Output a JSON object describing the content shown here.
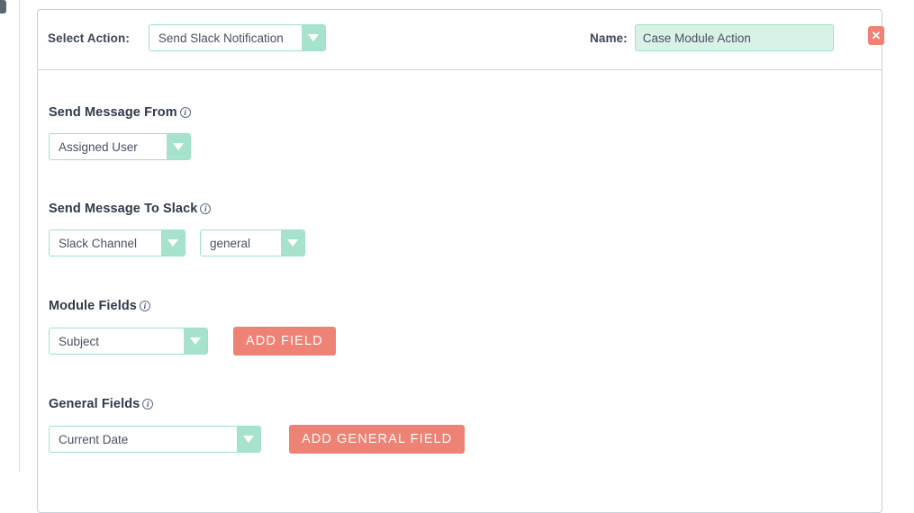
{
  "header": {
    "select_action_label": "Select Action:",
    "action_select": {
      "value": "Send Slack Notification",
      "icon": "chevron-down-icon"
    },
    "name_label": "Name:",
    "name_input": {
      "value": "Case Module Action",
      "placeholder": ""
    },
    "close_button": {
      "glyph": "✕",
      "icon": "close-icon"
    }
  },
  "sections": {
    "send_from": {
      "title": "Send Message From",
      "info_icon": "info-icon",
      "info_glyph": "i",
      "select": {
        "value": "Assigned User"
      }
    },
    "send_to_slack": {
      "title": "Send Message To Slack",
      "info_icon": "info-icon",
      "info_glyph": "i",
      "target_type_select": {
        "value": "Slack Channel"
      },
      "channel_select": {
        "value": "general"
      }
    },
    "module_fields": {
      "title": "Module Fields",
      "info_icon": "info-icon",
      "info_glyph": "i",
      "select": {
        "value": "Subject"
      },
      "add_button": "ADD FIELD"
    },
    "general_fields": {
      "title": "General Fields",
      "info_icon": "info-icon",
      "info_glyph": "i",
      "select": {
        "value": "Current Date"
      },
      "add_button": "ADD GENERAL FIELD"
    }
  },
  "colors": {
    "accent_green": "#a7e2cd",
    "accent_green_border": "#9fe0c9",
    "accent_coral": "#ed8275",
    "card_border": "#c5d2dd",
    "label_text": "#2f3a4c"
  }
}
